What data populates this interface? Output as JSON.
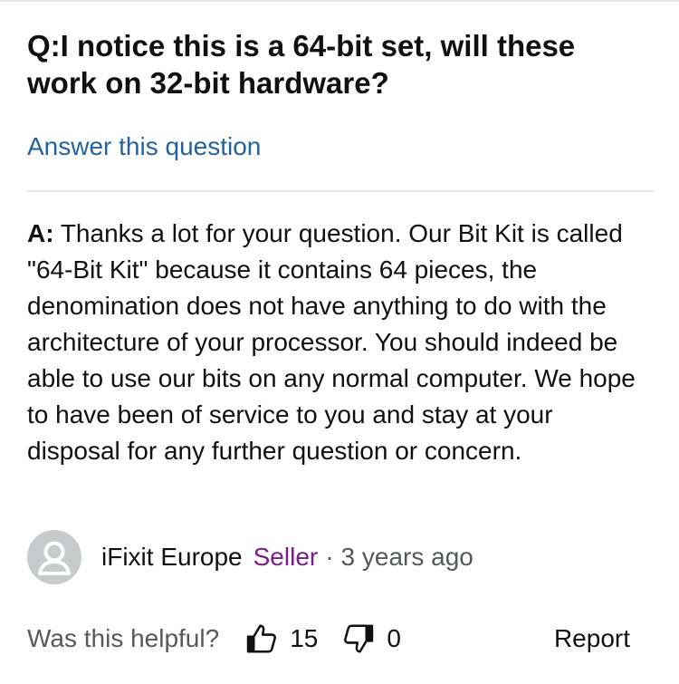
{
  "question": {
    "prefix": "Q:",
    "text": "I notice this is a 64-bit set, will these work on 32-bit hardware?"
  },
  "answer_link": "Answer this question",
  "answer": {
    "prefix": "A:",
    "text": " Thanks a lot for your question. Our Bit Kit is called \"64-Bit Kit\" because it contains 64 pieces, the denomination does not have anything to do with the architecture of your processor. You should indeed be able to use our bits on any normal computer. We hope to have been of service to you and stay at your disposal for any further question or concern."
  },
  "author": {
    "icon": "avatar-icon",
    "name": "iFixit Europe",
    "badge": "Seller",
    "separator": "·",
    "time": "3 years ago"
  },
  "feedback": {
    "label": "Was this helpful?",
    "up_icon": "thumbs-up-icon",
    "up_count": "15",
    "down_icon": "thumbs-down-icon",
    "down_count": "0",
    "report": "Report"
  },
  "colors": {
    "link": "#2162a1",
    "seller": "#7b1c8a",
    "secondary_text": "#565959",
    "divider": "#e3e6e6"
  }
}
